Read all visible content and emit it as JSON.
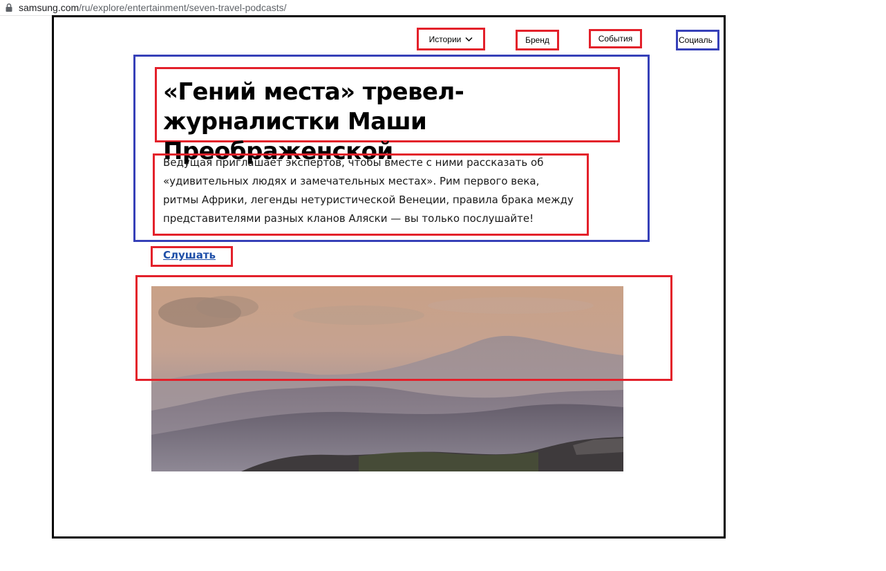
{
  "browser": {
    "url_domain": "samsung.com",
    "url_path": "/ru/explore/entertainment/seven-travel-podcasts/"
  },
  "nav": {
    "items": [
      {
        "label": "Истории"
      },
      {
        "label": "Бренд"
      },
      {
        "label": "События"
      },
      {
        "label": "Социаль"
      }
    ]
  },
  "article": {
    "title": "«Гений места» тревел-журналистки Маши Преображенской",
    "description": "Ведущая приглашает экспертов, чтобы вместе с ними рассказать об «удивительных людях и замечательных местах». Рим первого века, ритмы Африки, легенды нетуристической Венеции, правила брака между представителями разных кланов Аляски — вы только послушайте!",
    "listen_label": "Слушать"
  },
  "colors": {
    "annotation_red": "#e3202a",
    "annotation_blue": "#3640b8",
    "frame": "#000000",
    "link": "#1f4fa8"
  },
  "icons": {
    "lock": "lock-icon",
    "dropdown": "chevron-down-icon"
  }
}
